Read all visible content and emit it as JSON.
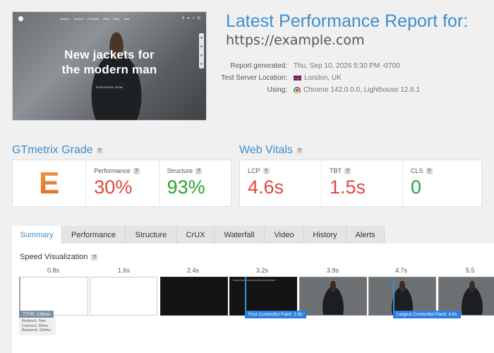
{
  "screenshot": {
    "nav_items": [
      "Women",
      "Explore",
      "Products",
      "Gifts",
      "Shop",
      "Sale"
    ],
    "nav_icons": [
      "search-icon",
      "user-icon",
      "cart-icon",
      "menu-icon"
    ],
    "headline_line1": "New jackets for",
    "headline_line2": "the modern man",
    "cta": "DISCOVER NOW"
  },
  "header": {
    "title": "Latest Performance Report for:",
    "url": "https://example.com",
    "meta": [
      {
        "label": "Report generated:",
        "value": "Thu, Sep 10, 2026 5:30 PM -0700",
        "icon": ""
      },
      {
        "label": "Test Server Location:",
        "value": "London, UK",
        "icon": "uk-flag-icon"
      },
      {
        "label": "Using:",
        "value": "Chrome 142.0.0.0, Lighthouse 12.6.1",
        "icon": "chrome-icon"
      }
    ]
  },
  "grade": {
    "title": "GTmetrix Grade",
    "letter": "E",
    "performance_label": "Performance",
    "performance_value": "30%",
    "structure_label": "Structure",
    "structure_value": "93%"
  },
  "vitals": {
    "title": "Web Vitals",
    "items": [
      {
        "label": "LCP",
        "value": "4.6s"
      },
      {
        "label": "TBT",
        "value": "1.5s"
      },
      {
        "label": "CLS",
        "value": "0"
      }
    ]
  },
  "colors": {
    "accent": "#3b8fd1",
    "bad": "#e0483e",
    "good": "#2ea12e",
    "grade": "#e07a2e"
  },
  "tabs": [
    {
      "label": "Summary",
      "active": true
    },
    {
      "label": "Performance",
      "active": false
    },
    {
      "label": "Structure",
      "active": false
    },
    {
      "label": "CrUX",
      "active": false
    },
    {
      "label": "Waterfall",
      "active": false
    },
    {
      "label": "Video",
      "active": false
    },
    {
      "label": "History",
      "active": false
    },
    {
      "label": "Alerts",
      "active": false
    }
  ],
  "speed_visualization": {
    "title": "Speed Visualization",
    "ticks": [
      "0.8s",
      "1.6s",
      "2.4s",
      "3.2s",
      "3.9s",
      "4.7s",
      "5.5"
    ],
    "ttfb_label": "TTFB: 136ms",
    "ttfb_details": [
      "Redirect: 0ms",
      "Connect: 36ms",
      "Backend: 100ms"
    ],
    "fcp_label": "First Contentful Paint: 2.9s",
    "lcp_label": "Largest Contentful Paint: 4.6s"
  }
}
